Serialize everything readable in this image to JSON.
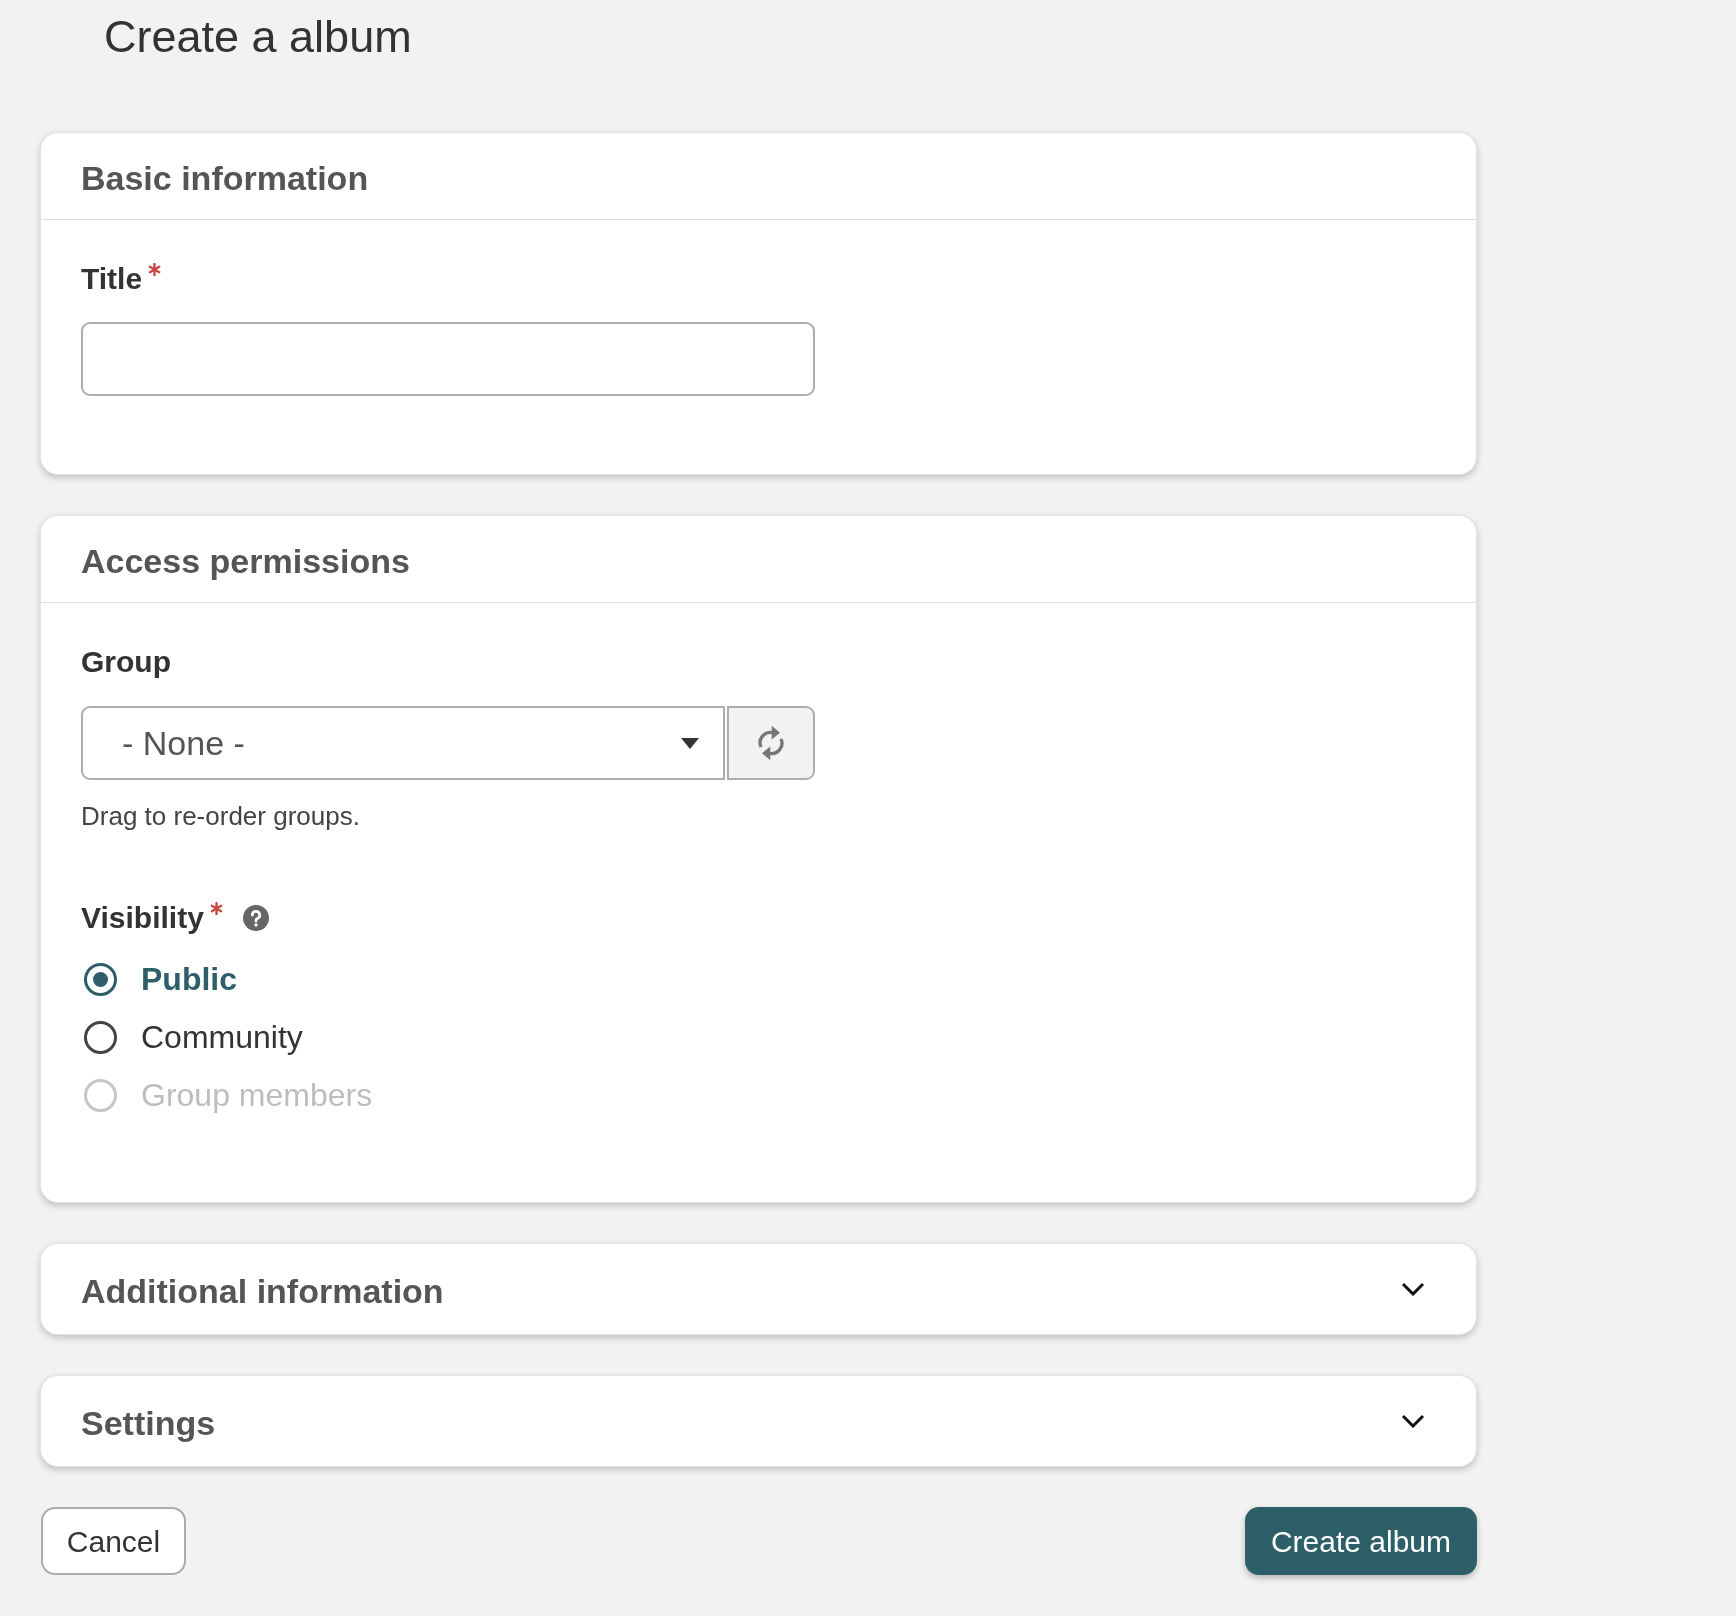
{
  "page_title": "Create a album",
  "sections": [
    {
      "kind": "panel",
      "title": "Basic information",
      "fields": [
        {
          "kind": "text",
          "label": "Title",
          "required": true
        }
      ]
    },
    {
      "kind": "panel",
      "title": "Access permissions",
      "fields": [
        {
          "kind": "select",
          "label": "Group",
          "required": false,
          "value": "- None -",
          "hint": "Drag to re-order groups."
        },
        {
          "kind": "radio",
          "label": "Visibility",
          "required": true,
          "help": true,
          "options": [
            {
              "label": "Public",
              "selected": true,
              "disabled": false
            },
            {
              "label": "Community",
              "selected": false,
              "disabled": false
            },
            {
              "label": "Group members",
              "selected": false,
              "disabled": true
            }
          ]
        }
      ]
    },
    {
      "kind": "collapsible",
      "title": "Additional information",
      "expanded": false
    },
    {
      "kind": "collapsible",
      "title": "Settings",
      "expanded": false
    }
  ],
  "buttons": [
    {
      "kind": "secondary",
      "label": "Cancel"
    },
    {
      "kind": "primary",
      "label": "Create album"
    }
  ]
}
